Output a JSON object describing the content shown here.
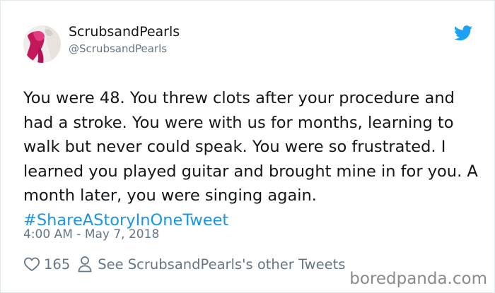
{
  "tweet": {
    "display_name": "ScrubsandPearls",
    "handle": "@ScrubsandPearls",
    "text_before_hashtag": "You were 48. You threw clots after your procedure and had a stroke. You were with us for months, learning to walk but never could speak. You were so frustrated. I learned you played guitar and brought mine in for you. A month later, you were singing again. ",
    "hashtag": "#ShareAStoryInOneTweet",
    "timestamp": "4:00 AM - May 7, 2018",
    "like_count": "165",
    "other_tweets_link": "See ScrubsandPearls's other Tweets",
    "icons": [
      "twitter-bird-icon",
      "heart-icon",
      "person-icon"
    ]
  },
  "watermark": "boredpanda.com",
  "colors": {
    "text": "#14171a",
    "secondary": "#657786",
    "link": "#1b95e0",
    "twitter_blue": "#1da1f2",
    "avatar_accent": "#c2185b"
  }
}
